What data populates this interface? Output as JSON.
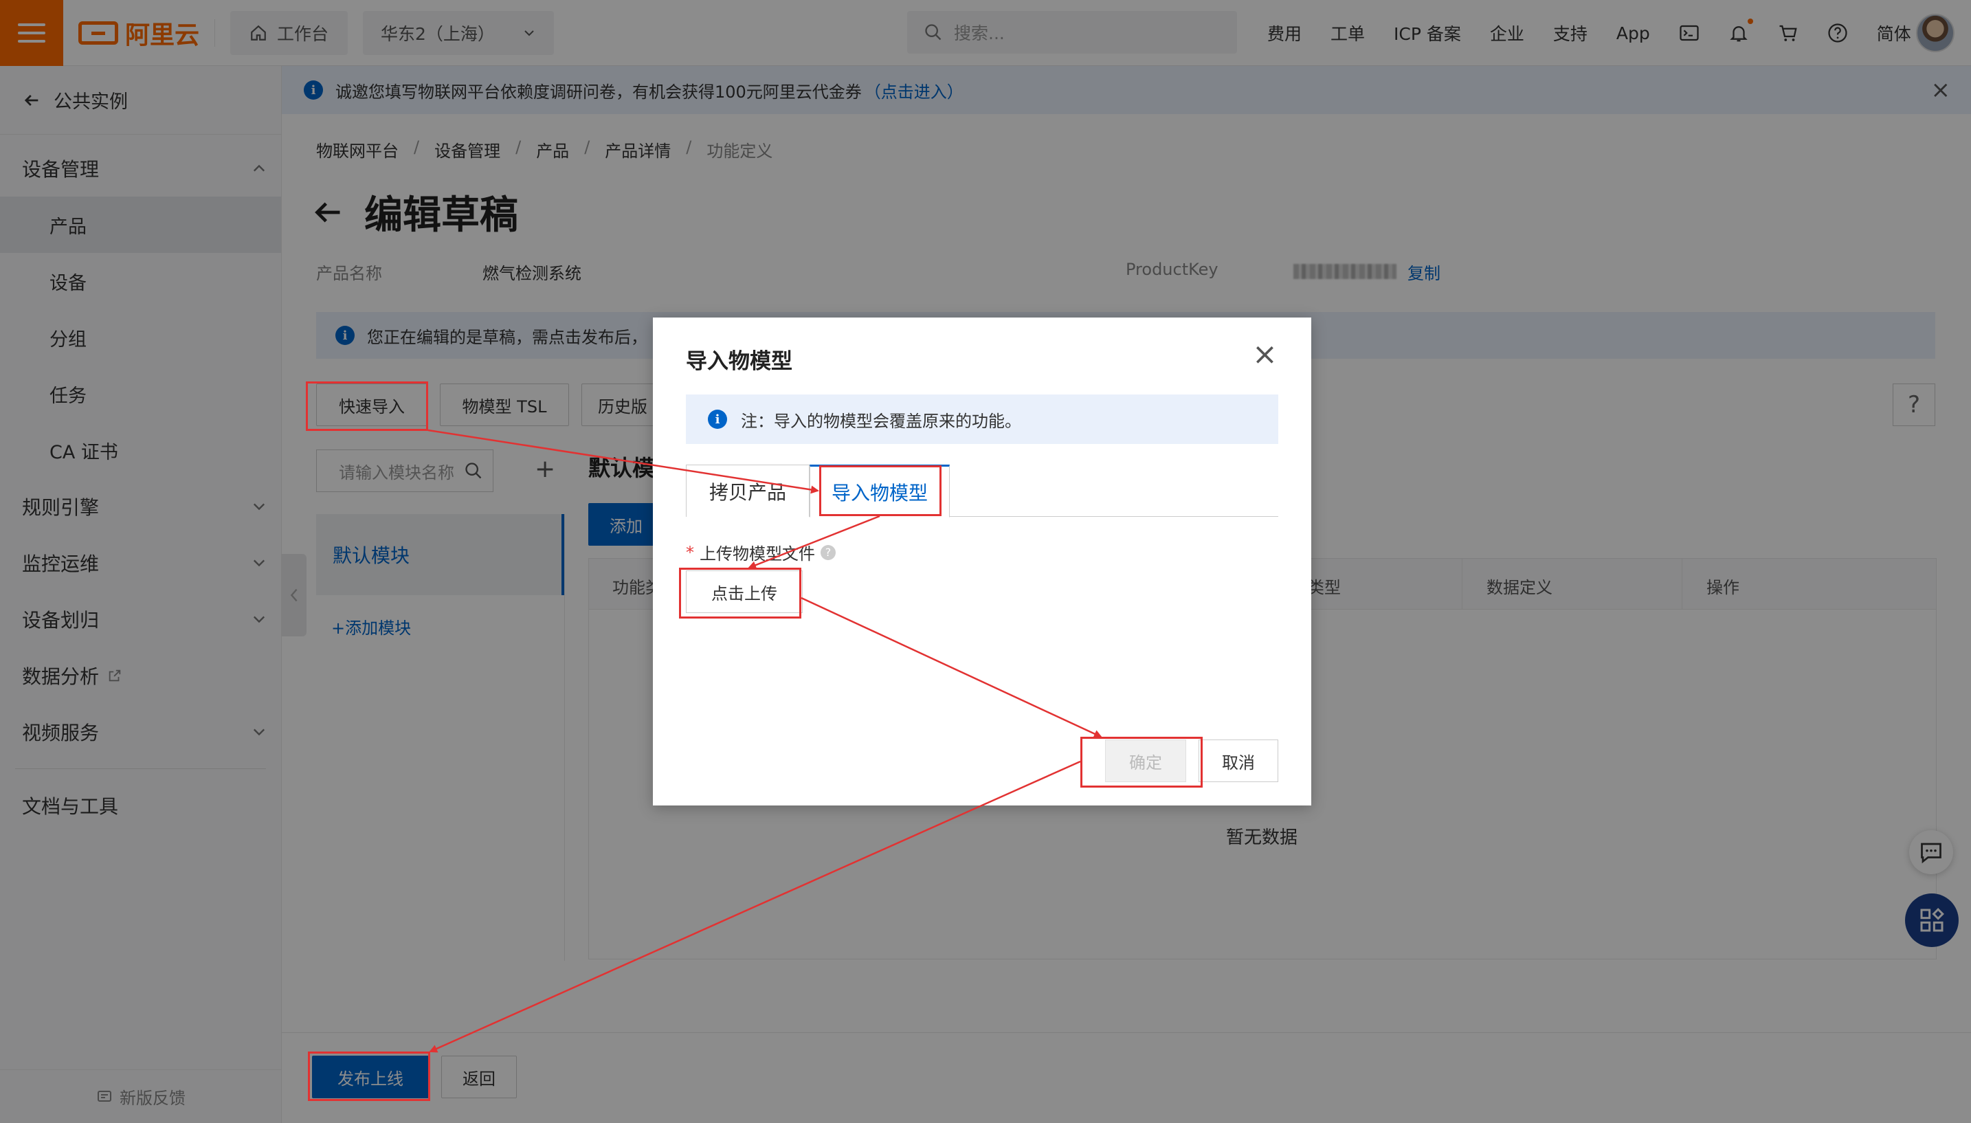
{
  "topbar": {
    "brand": "阿里云",
    "workbench": "工作台",
    "region": "华东2（上海）",
    "search_placeholder": "搜索...",
    "links": [
      "费用",
      "工单",
      "ICP 备案",
      "企业",
      "支持",
      "App"
    ],
    "lang": "简体",
    "icons": [
      "terminal-icon",
      "bell-icon",
      "cart-icon",
      "help-icon"
    ]
  },
  "sidebar": {
    "back_label": "公共实例",
    "group_device": "设备管理",
    "items": [
      "产品",
      "设备",
      "分组",
      "任务",
      "CA 证书"
    ],
    "active_item": "产品",
    "groups": [
      "规则引擎",
      "监控运维",
      "设备划归",
      "数据分析",
      "视频服务"
    ],
    "docs": "文档与工具",
    "feedback": "新版反馈"
  },
  "notice": {
    "text": "诚邀您填写物联网平台依赖度调研问卷，有机会获得100元阿里云代金券",
    "link": "（点击进入）"
  },
  "breadcrumb": [
    "物联网平台",
    "设备管理",
    "产品",
    "产品详情",
    "功能定义"
  ],
  "page": {
    "title": "编辑草稿",
    "product_name_label": "产品名称",
    "product_name": "燃气检测系统",
    "product_key_label": "ProductKey",
    "copy_link": "复制",
    "draft_notice": "您正在编辑的是草稿，需点击发布后，",
    "quick_import": "快速导入",
    "tsl_button": "物模型 TSL",
    "history_button": "历史版",
    "module_search_placeholder": "请输入模块名称",
    "section_title": "默认模",
    "add_button": "添加",
    "module_default": "默认模块",
    "module_add": "+添加模块",
    "table_headers": [
      "功能类",
      "类型",
      "数据定义",
      "操作"
    ],
    "empty": "暂无数据",
    "publish": "发布上线",
    "back": "返回"
  },
  "modal": {
    "title": "导入物模型",
    "note": "注：导入的物模型会覆盖原来的功能。",
    "tabs": [
      "拷贝产品",
      "导入物模型"
    ],
    "active_tab": "导入物模型",
    "upload_label": "上传物模型文件",
    "upload_button": "点击上传",
    "ok": "确定",
    "cancel": "取消"
  },
  "colors": {
    "brand_orange": "#ff6a00",
    "primary_blue": "#0064c8",
    "annotation_red": "#e23232"
  }
}
